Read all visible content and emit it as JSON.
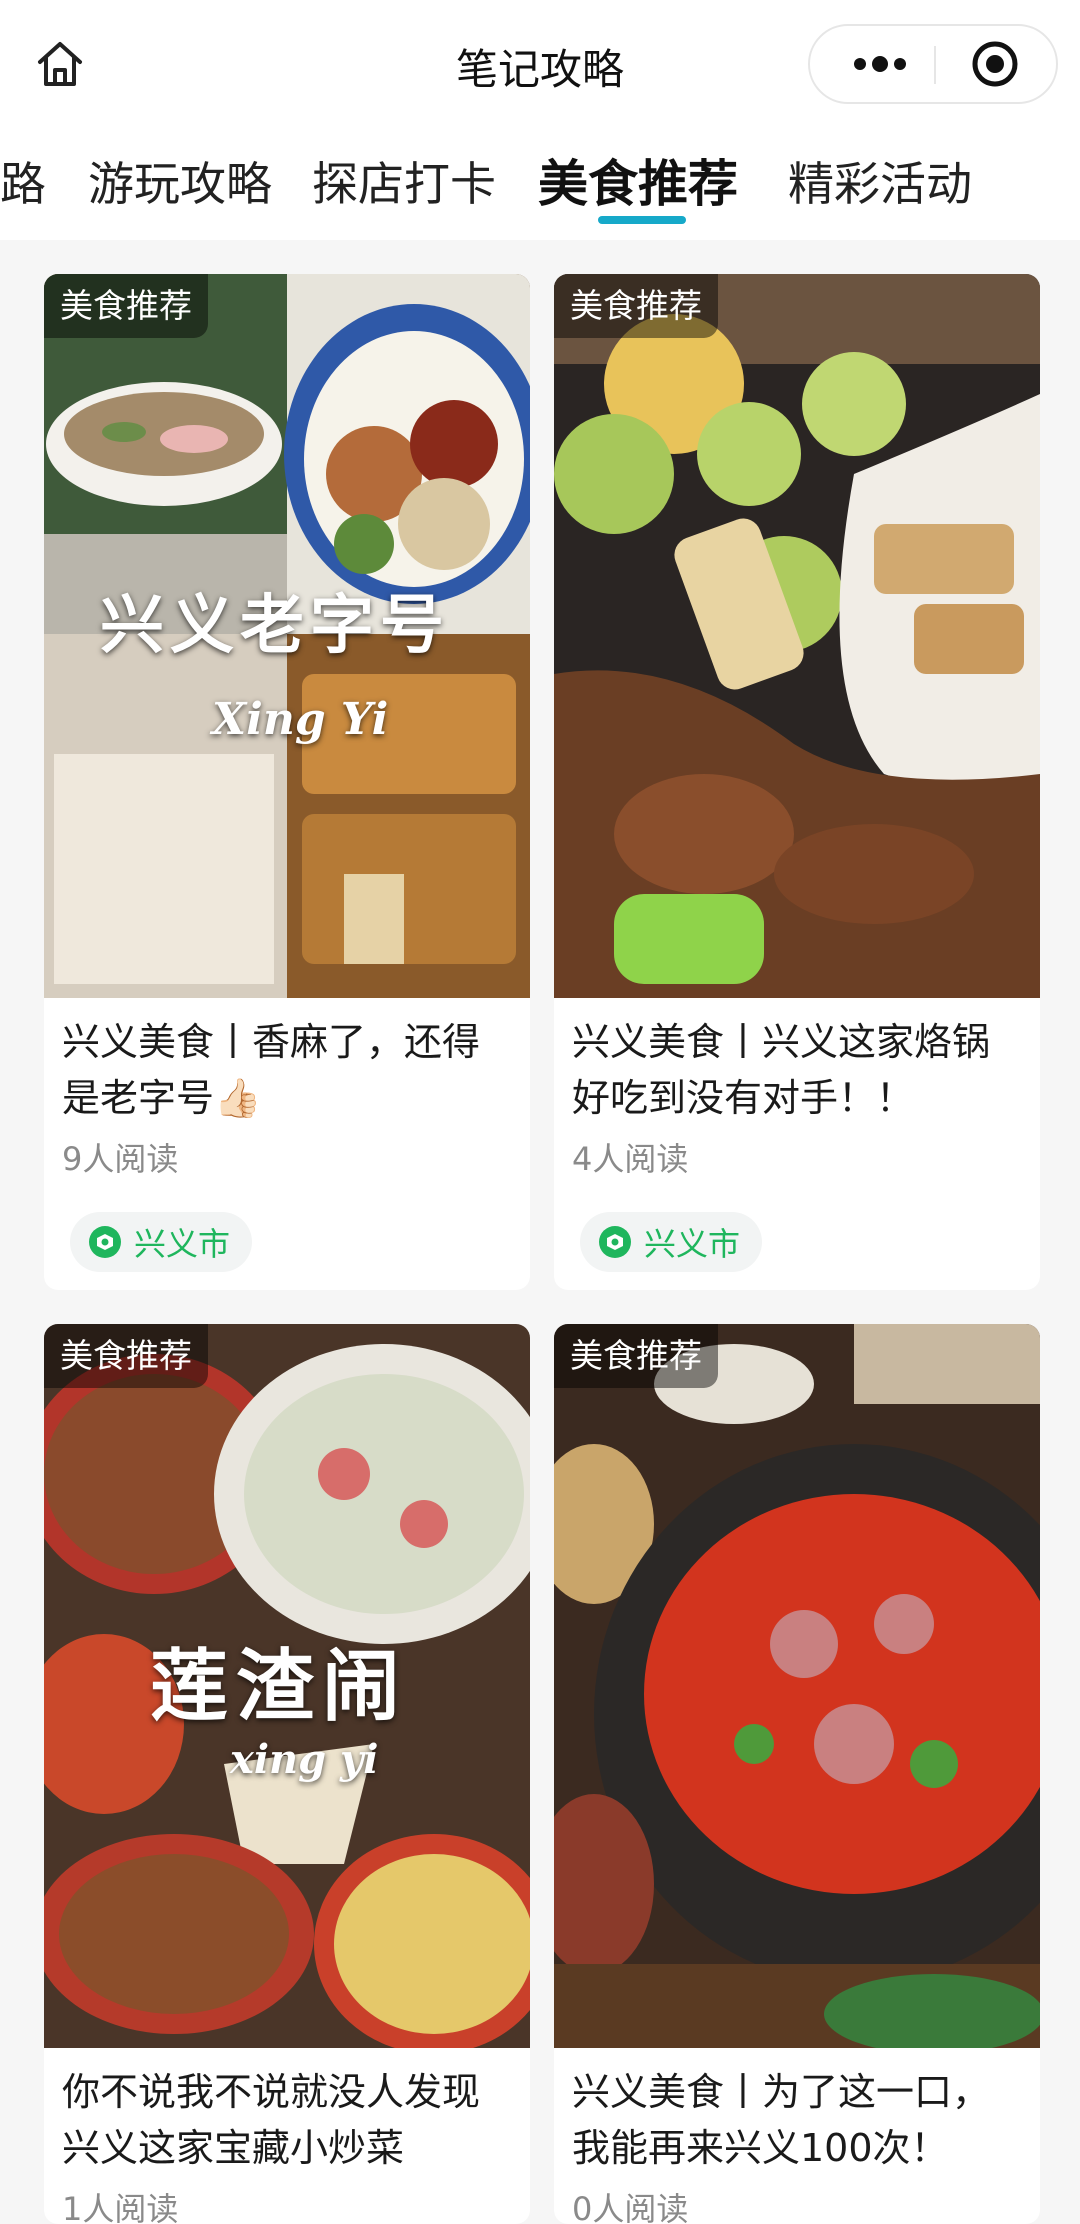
{
  "header": {
    "title": "笔记攻略",
    "home_icon": "home-icon",
    "more_icon": "more-dots-icon",
    "close_icon": "target-close-icon"
  },
  "tabs": [
    {
      "label": "路"
    },
    {
      "label": "游玩攻略"
    },
    {
      "label": "探店打卡"
    },
    {
      "label": "美食推荐",
      "active": true
    },
    {
      "label": "精彩活动"
    }
  ],
  "accent_color": "#16a9c9",
  "tag_color": "#1fb65d",
  "cards": [
    {
      "badge": "美食推荐",
      "title": "兴义美食丨香麻了，还得是老字号👍🏻",
      "reads": "9人阅读",
      "location": "兴义市",
      "overlay_title": "兴义老字号",
      "overlay_sub": "Xing Yi"
    },
    {
      "badge": "美食推荐",
      "title": "兴义美食丨兴义这家烙锅好吃到没有对手！！",
      "reads": "4人阅读",
      "location": "兴义市"
    },
    {
      "badge": "美食推荐",
      "title": "你不说我不说就没人发现兴义这家宝藏小炒菜",
      "reads": "1人阅读",
      "overlay_title": "莲渣闹",
      "overlay_sub": "xing yi"
    },
    {
      "badge": "美食推荐",
      "title": "兴义美食丨为了这一口，我能再来兴义100次！",
      "reads": "0人阅读"
    }
  ]
}
